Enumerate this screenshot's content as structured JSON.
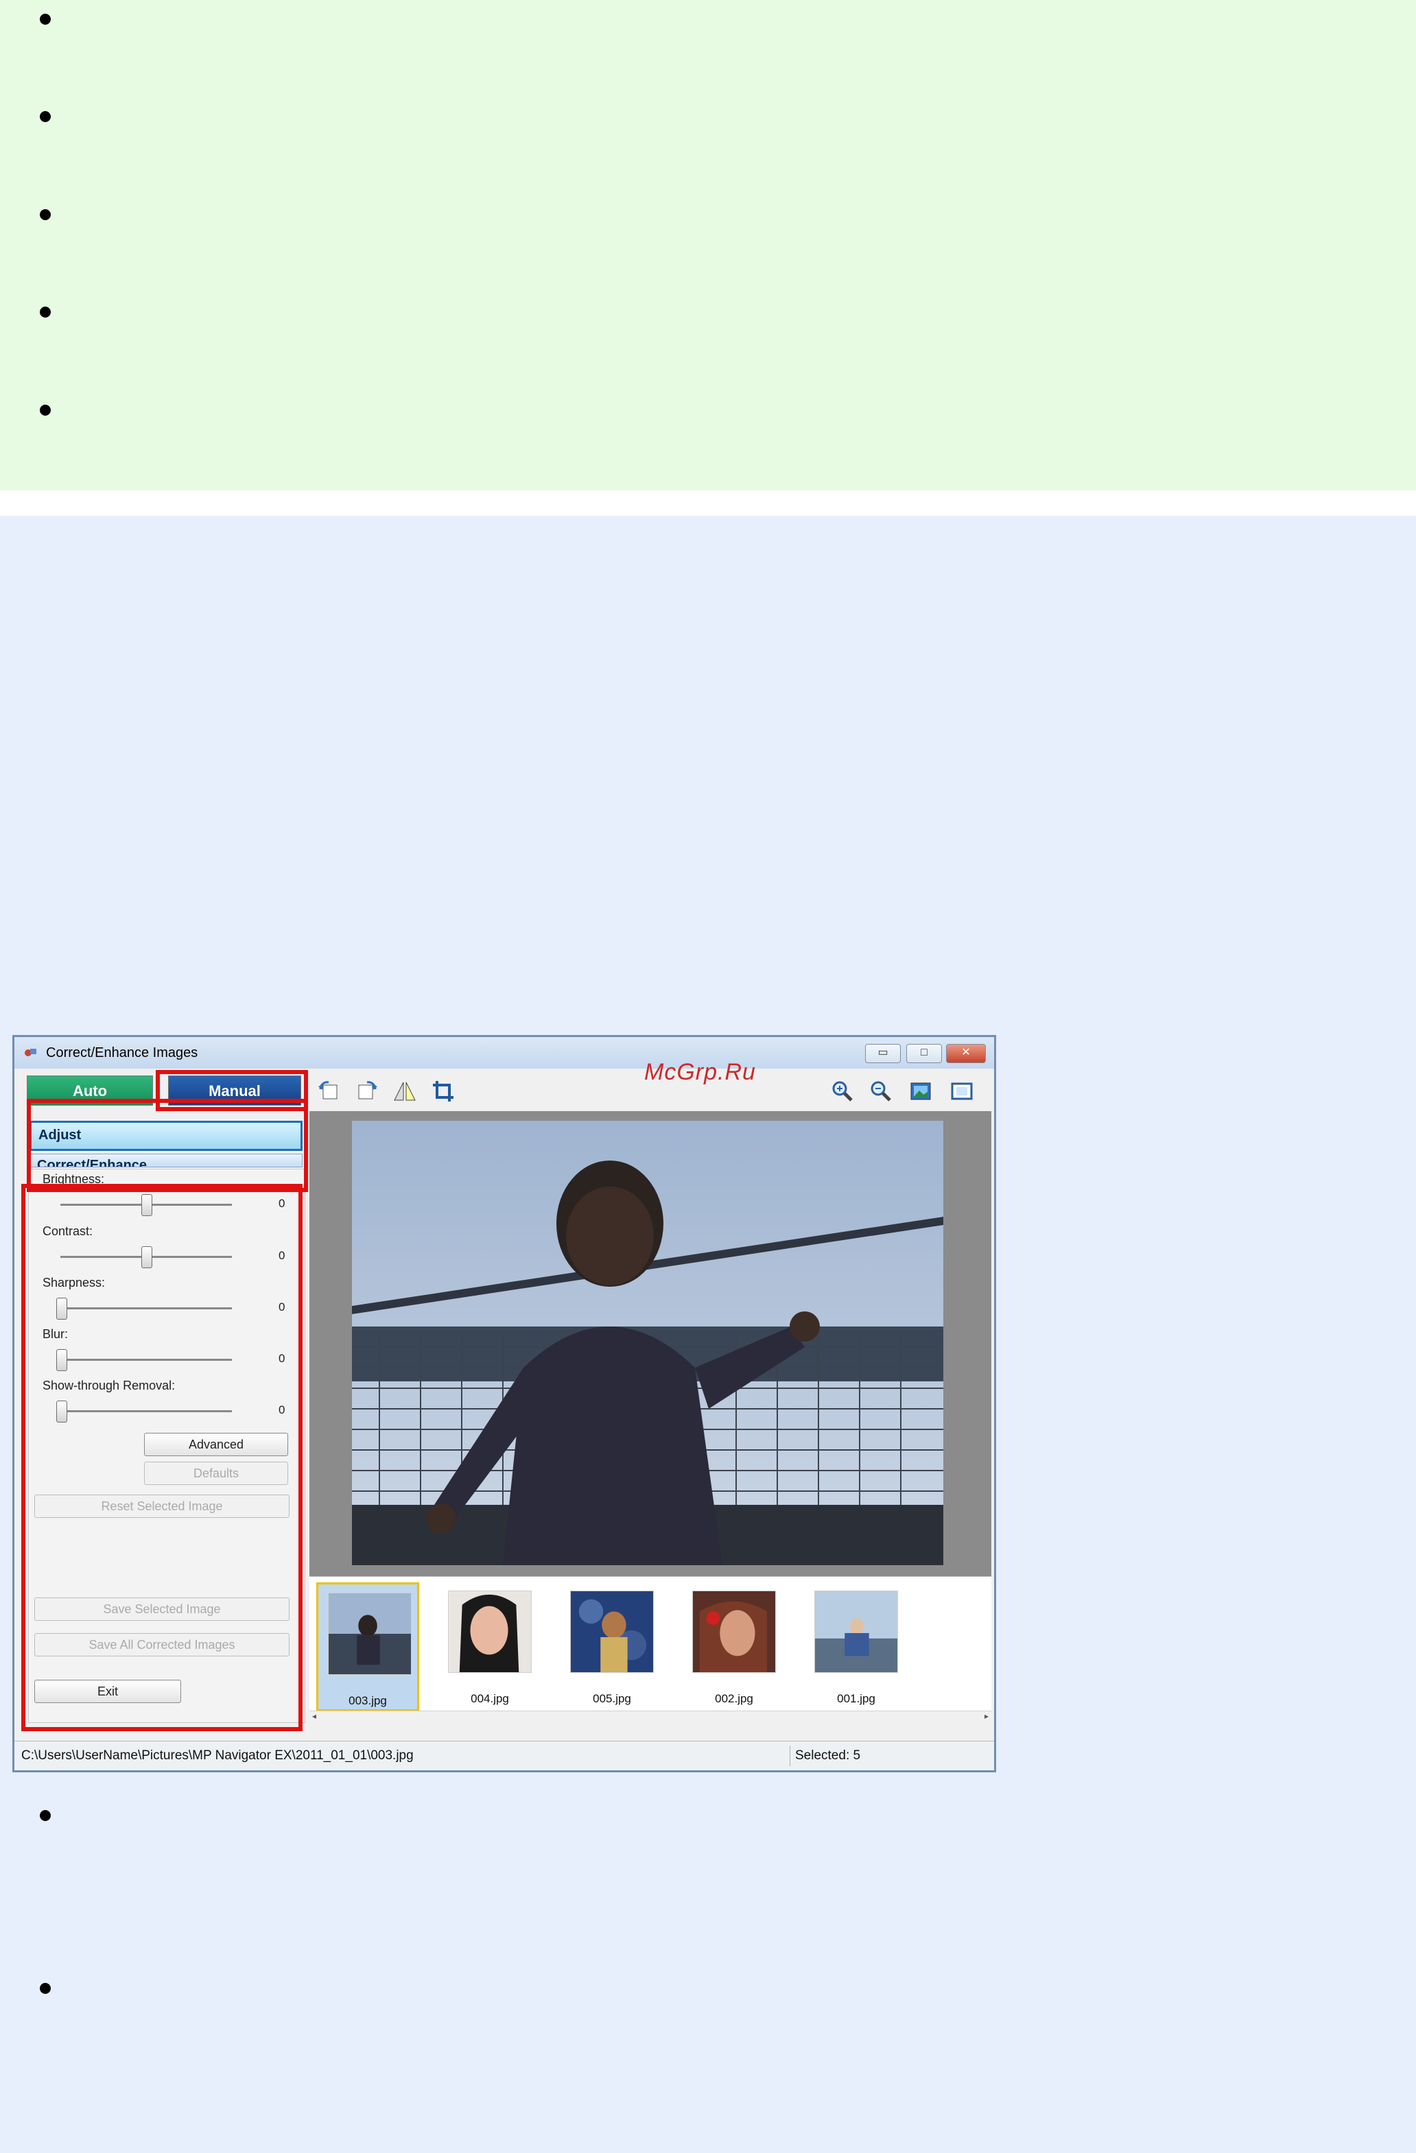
{
  "window": {
    "title": "Correct/Enhance Images",
    "controls": [
      "minimize",
      "maximize",
      "close"
    ]
  },
  "watermark": "McGrp.Ru",
  "tabs": {
    "auto": "Auto",
    "manual": "Manual"
  },
  "sections": {
    "adjust": "Adjust",
    "correct_enhance": "Correct/Enhance"
  },
  "sliders": [
    {
      "label": "Brightness:",
      "value": "0"
    },
    {
      "label": "Contrast:",
      "value": "0"
    },
    {
      "label": "Sharpness:",
      "value": "0"
    },
    {
      "label": "Blur:",
      "value": "0"
    },
    {
      "label": "Show-through Removal:",
      "value": "0"
    }
  ],
  "buttons": {
    "advanced": "Advanced",
    "defaults": "Defaults",
    "reset_selected": "Reset Selected Image",
    "save_selected": "Save Selected Image",
    "save_all": "Save All Corrected Images",
    "exit": "Exit"
  },
  "toolbar_icons": [
    "rotate-left-icon",
    "rotate-right-icon",
    "flip-icon",
    "crop-icon",
    "zoom-in-icon",
    "zoom-out-icon",
    "fit-image-icon",
    "full-screen-icon"
  ],
  "thumbnails": [
    {
      "label": "003.jpg",
      "selected": true
    },
    {
      "label": "004.jpg",
      "selected": false
    },
    {
      "label": "005.jpg",
      "selected": false
    },
    {
      "label": "002.jpg",
      "selected": false
    },
    {
      "label": "001.jpg",
      "selected": false
    }
  ],
  "status": {
    "path": "C:\\Users\\UserName\\Pictures\\MP Navigator EX\\2011_01_01\\003.jpg",
    "selected": "Selected: 5"
  }
}
